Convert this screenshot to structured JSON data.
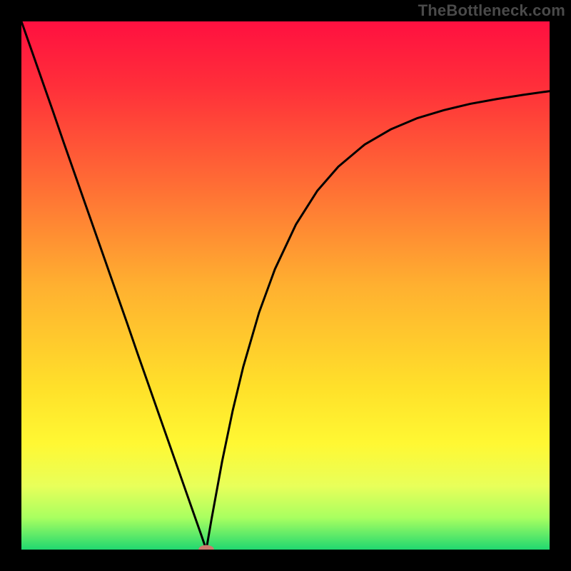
{
  "watermark": "TheBottleneck.com",
  "colors": {
    "frame": "#000000",
    "curve": "#000000",
    "marker_fill": "#cc7a6e",
    "gradient_stops": [
      {
        "offset": 0.0,
        "color": "#ff1040"
      },
      {
        "offset": 0.12,
        "color": "#ff2e3a"
      },
      {
        "offset": 0.3,
        "color": "#ff6a35"
      },
      {
        "offset": 0.5,
        "color": "#ffb030"
      },
      {
        "offset": 0.7,
        "color": "#ffe22a"
      },
      {
        "offset": 0.8,
        "color": "#fff833"
      },
      {
        "offset": 0.88,
        "color": "#e8ff5a"
      },
      {
        "offset": 0.94,
        "color": "#a8ff60"
      },
      {
        "offset": 1.0,
        "color": "#20d870"
      }
    ]
  },
  "chart_data": {
    "type": "line",
    "x": [
      0.0,
      0.02,
      0.04,
      0.06,
      0.08,
      0.1,
      0.12,
      0.14,
      0.16,
      0.18,
      0.2,
      0.22,
      0.24,
      0.26,
      0.28,
      0.3,
      0.32,
      0.34,
      0.35,
      0.36,
      0.38,
      0.4,
      0.42,
      0.45,
      0.48,
      0.52,
      0.56,
      0.6,
      0.65,
      0.7,
      0.75,
      0.8,
      0.85,
      0.9,
      0.95,
      1.0
    ],
    "y": [
      1.0,
      0.943,
      0.886,
      0.829,
      0.771,
      0.714,
      0.657,
      0.6,
      0.543,
      0.486,
      0.429,
      0.371,
      0.314,
      0.257,
      0.2,
      0.143,
      0.086,
      0.029,
      0.0,
      0.058,
      0.167,
      0.263,
      0.346,
      0.449,
      0.531,
      0.616,
      0.679,
      0.725,
      0.767,
      0.796,
      0.817,
      0.832,
      0.844,
      0.853,
      0.861,
      0.868
    ],
    "title": "",
    "xlabel": "",
    "ylabel": "",
    "xlim": [
      0,
      1
    ],
    "ylim": [
      0,
      1
    ],
    "marker": {
      "x": 0.35,
      "y": 0.0,
      "rx": 0.014,
      "ry": 0.008
    },
    "annotations": []
  }
}
